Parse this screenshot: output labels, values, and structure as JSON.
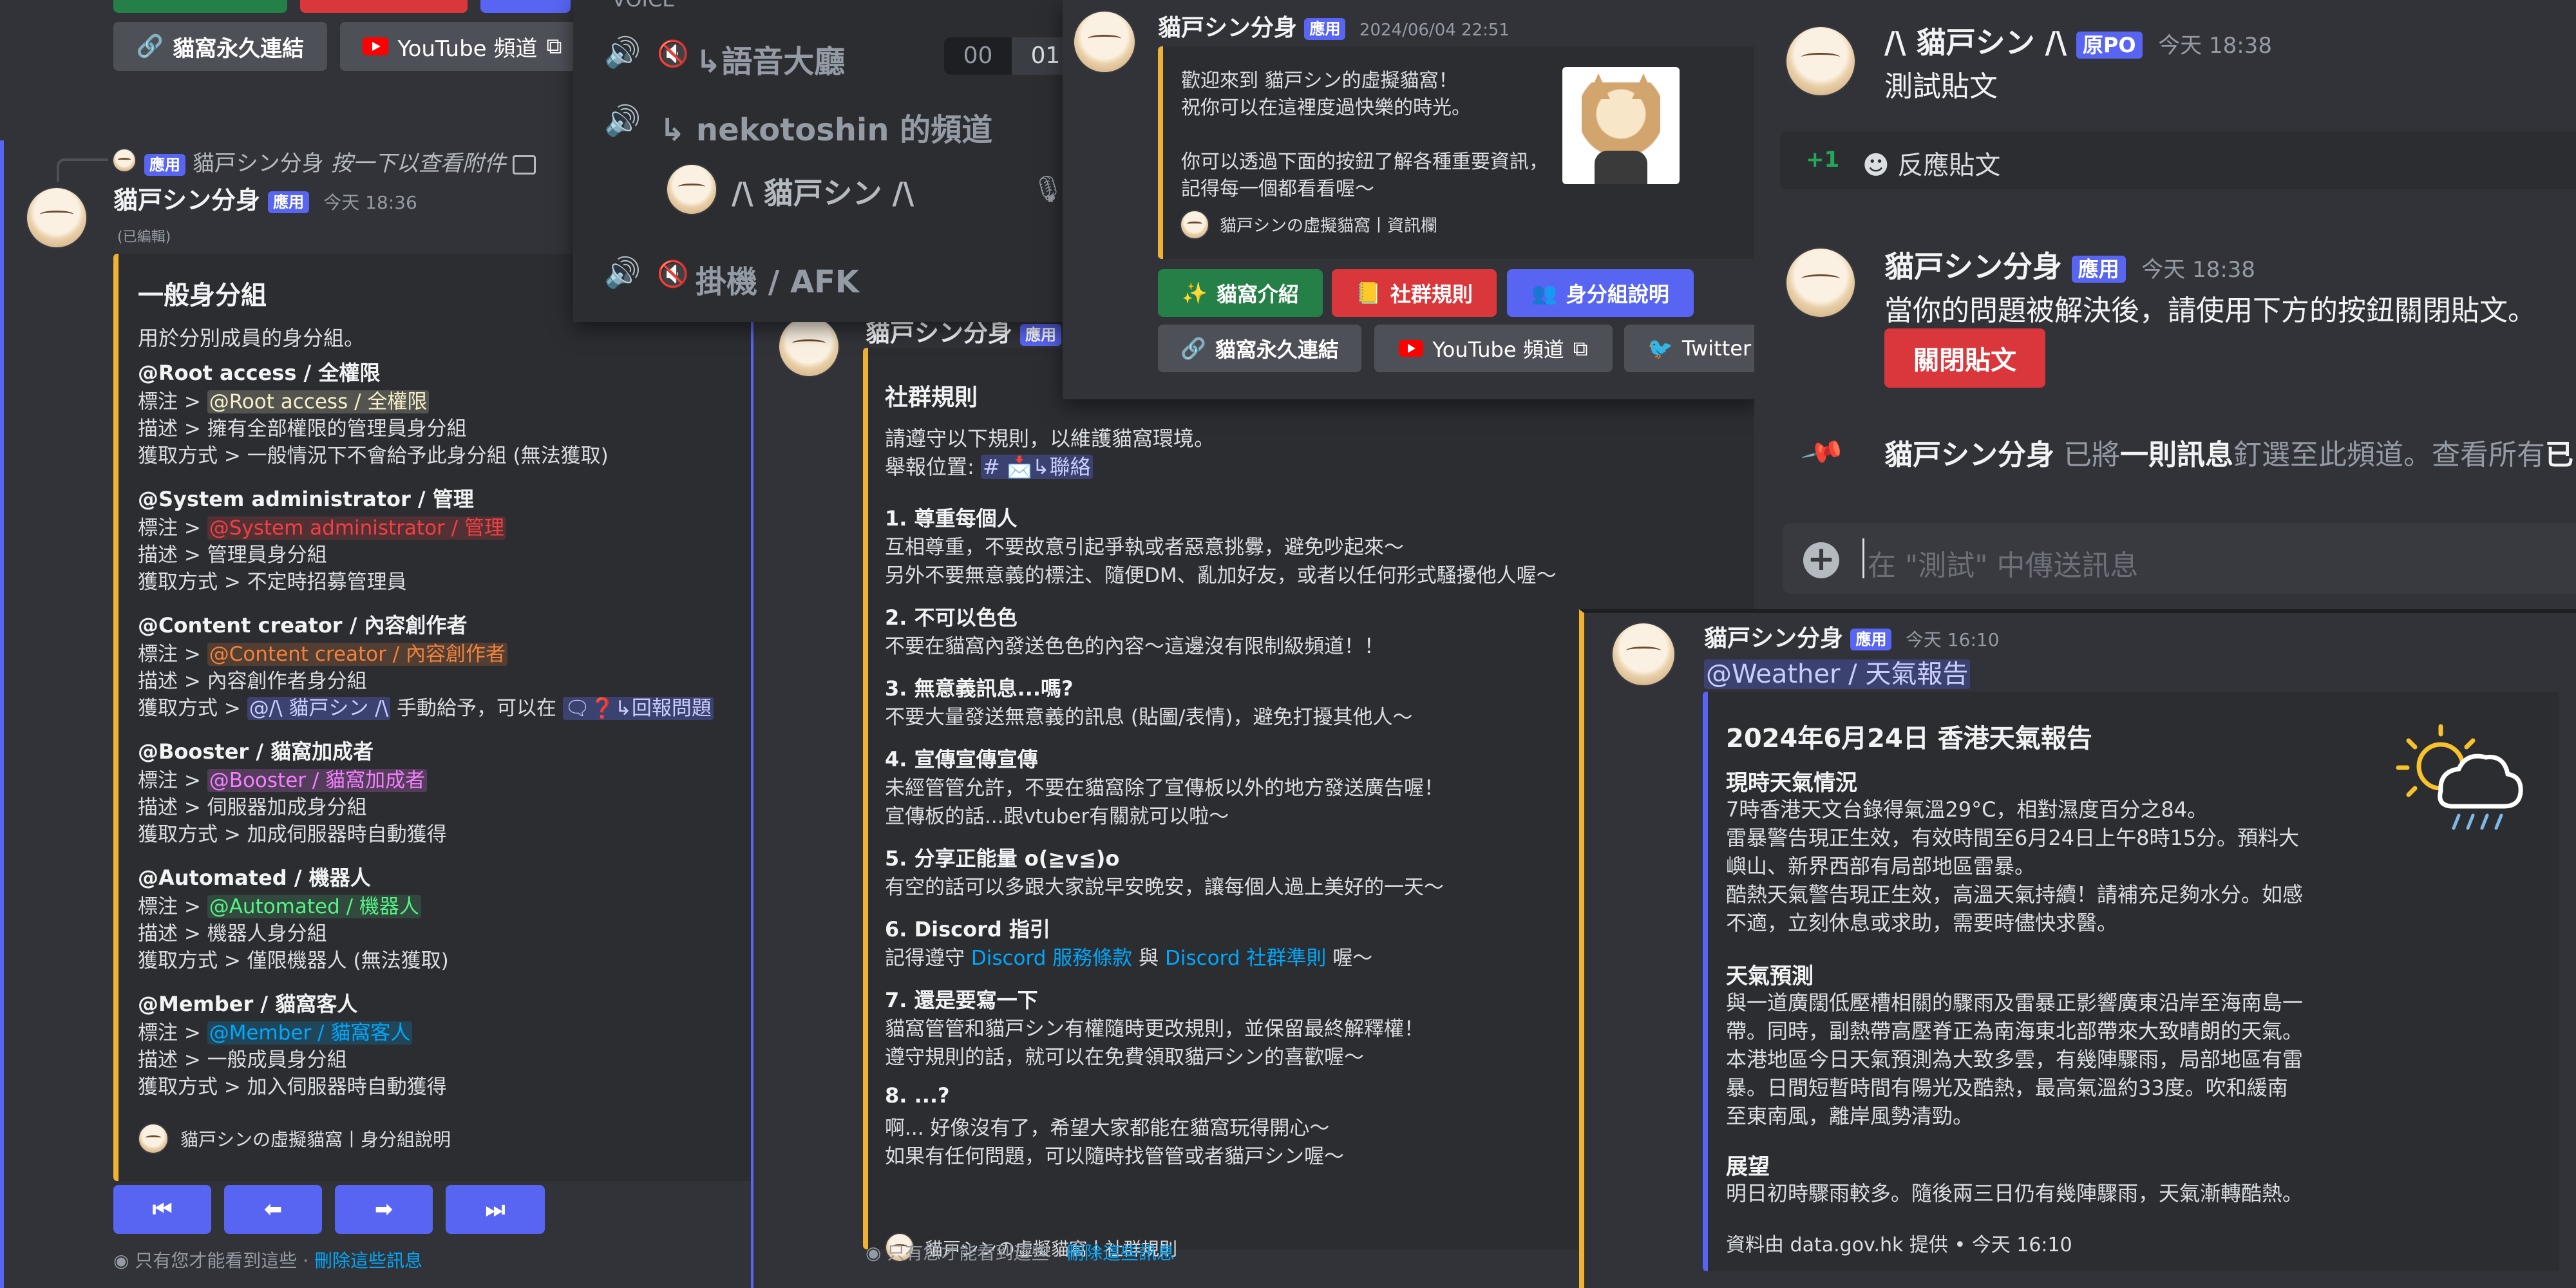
{
  "p1": {
    "top_buttons": {
      "perma": "貓窩永久連結",
      "youtube": "YouTube 頻道"
    },
    "reply": {
      "tag": "應用",
      "author": "貓戸シン分身",
      "text": "按一下以查看附件"
    },
    "author": "貓戸シン分身",
    "tag": "應用",
    "time": "今天 18:36",
    "edited": "(已編輯)",
    "embed": {
      "title": "一般身分組",
      "desc": "用於分別成員的身分組。",
      "sections": [
        {
          "head": "@Root access / 全權限",
          "l1a": "標注 > ",
          "l1b": "@Root access / 全權限",
          "l2": "描述 > 擁有全部權限的管理員身分組",
          "l3": "獲取方式 > 一般情況下不會給予此身分組 (無法獲取)",
          "color": "#f5f0c8",
          "bg": "rgba(245,240,200,0.2)"
        },
        {
          "head": "@System administrator / 管理",
          "l1a": "標注 > ",
          "l1b": "@System administrator / 管理",
          "l2": "描述 > 管理員身分組",
          "l3": "獲取方式 > 不定時招募管理員",
          "color": "#f23f43",
          "bg": "rgba(242,63,67,0.2)"
        },
        {
          "head": "@Content creator / 內容創作者",
          "l1a": "標注 > ",
          "l1b": "@Content creator / 內容創作者",
          "l2": "描述 > 內容創作者身分組",
          "l3": "獲取方式 > ",
          "color": "#f0823c",
          "bg": "rgba(240,130,60,0.2)"
        },
        {
          "head": "@Booster / 貓窩加成者",
          "l1a": "標注 > ",
          "l1b": "@Booster / 貓窩加成者",
          "l2": "描述 > 伺服器加成身分組",
          "l3": "獲取方式 > 加成伺服器時自動獲得",
          "color": "#f47fff",
          "bg": "rgba(244,127,255,0.2)"
        },
        {
          "head": "@Automated / 機器人",
          "l1a": "標注 > ",
          "l1b": "@Automated / 機器人",
          "l2": "描述 > 機器人身分組",
          "l3": "獲取方式 > 僅限機器人 (無法獲取)",
          "color": "#57f287",
          "bg": "rgba(87,242,135,0.15)"
        },
        {
          "head": "@Member / 貓窩客人",
          "l1a": "標注 > ",
          "l1b": "@Member / 貓窩客人",
          "l2": "描述 > 一般成員身分組",
          "l3": "獲取方式 > 加入伺服器時自動獲得",
          "color": "#00a8fc",
          "bg": "rgba(0,168,252,0.2)"
        }
      ],
      "cc_mention": "@/\\ 貓戸シン /\\",
      "cc_text": "手動給予，可以在",
      "cc_channel": "↳回報問題",
      "footer": "貓戸シンの虛擬貓窩丨身分組說明"
    },
    "nav": [
      "⏮",
      "⬅",
      "➡",
      "⏭"
    ],
    "ephemeral": {
      "text": "只有您才能看到這些 · ",
      "link": "刪除這些訊息"
    }
  },
  "p2": {
    "top": "VOICE",
    "channels": [
      {
        "name": "↳語音大廳",
        "count_a": "00",
        "count_b": "01"
      },
      {
        "name": "↳ nekotoshin 的頻道"
      },
      {
        "name": "掛機 / AFK"
      }
    ],
    "user": "/\\ 貓戸シン /\\"
  },
  "p3": {
    "author": "貓戸シン分身",
    "tag": "應用",
    "embed": {
      "title": "社群規則",
      "intro1": "請遵守以下規則，以維護貓窩環境。",
      "intro2a": "舉報位置: ",
      "intro2b": "# 📩↳聯絡",
      "rules": [
        {
          "h": "1. 尊重每個人",
          "l": [
            "互相尊重，不要故意引起爭執或者惡意挑釁，避免吵起來～",
            "另外不要無意義的標注、隨便DM、亂加好友，或者以任何形式騷擾他人喔～"
          ]
        },
        {
          "h": "2. 不可以色色",
          "l": [
            "不要在貓窩內發送色色的內容～這邊沒有限制級頻道！！"
          ]
        },
        {
          "h": "3. 無意義訊息...嗎?",
          "l": [
            "不要大量發送無意義的訊息 (貼圖/表情)，避免打擾其他人～"
          ]
        },
        {
          "h": "4. 宣傳宣傳宣傳",
          "l": [
            "未經管管允許，不要在貓窩除了宣傳板以外的地方發送廣告喔！",
            "宣傳板的話...跟vtuber有關就可以啦～"
          ]
        },
        {
          "h": "5. 分享正能量 o(≧v≦)o",
          "l": [
            "有空的話可以多跟大家說早安晚安，讓每個人過上美好的一天～"
          ]
        },
        {
          "h": "6. Discord 指引",
          "l": []
        },
        {
          "h": "7. 還是要寫一下",
          "l": [
            "貓窩管管和貓戸シン有權隨時更改規則，並保留最終解釋權！",
            "遵守規則的話，就可以在免費領取貓戸シン的喜歡喔～"
          ]
        },
        {
          "h": "8. ...?",
          "l": [
            "啊... 好像沒有了，希望大家都能在貓窩玩得開心～",
            "如果有任何問題，可以隨時找管管或者貓戸シン喔～"
          ]
        }
      ],
      "d6a": "記得遵守 ",
      "d6b": "Discord 服務條款",
      "d6c": " 與 ",
      "d6d": "Discord 社群準則",
      "d6e": " 喔～",
      "footer": "貓戸シンの虛擬貓窩丨社群規則"
    },
    "ephemeral": {
      "text": "只有您才能看到這些 · ",
      "link": "刪除這些訊息"
    }
  },
  "p4": {
    "author": "貓戸シン分身",
    "tag": "應用",
    "time": "2024/06/04 22:51",
    "lines": [
      "歡迎來到 貓戸シン的虛擬貓窩！",
      "祝你可以在這裡度過快樂的時光。",
      "",
      "你可以透過下面的按鈕了解各種重要資訊，",
      "記得每一個都看看喔～"
    ],
    "footer": "貓戸シンの虛擬貓窩丨資訊欄",
    "b_intro": "貓窩介紹",
    "b_rules": "社群規則",
    "b_roles": "身分組說明",
    "b_perma": "貓窩永久連結",
    "b_yt": "YouTube 頻道",
    "b_tw": "Twitter"
  },
  "p5": {
    "op": {
      "author": "/\\ 貓戸シン /\\",
      "tag": "原PO",
      "time": "今天 18:38",
      "text": "測試貼文"
    },
    "reaction": {
      "count": "+1",
      "label": "反應貼文"
    },
    "msg": {
      "author": "貓戸シン分身",
      "tag": "應用",
      "time": "今天 18:38",
      "text": "當你的問題被解決後，請使用下方的按鈕關閉貼文。",
      "button": "關閉貼文"
    },
    "pin": {
      "author": "貓戸シン分身",
      "t1": " 已將",
      "t2": "一則訊息",
      "t3": "釘選至此頻道。查看所有",
      "t4": "已"
    },
    "input_placeholder": "在 \"測試\" 中傳送訊息"
  },
  "p6": {
    "author": "貓戸シン分身",
    "tag": "應用",
    "time": "今天 16:10",
    "mention": "@Weather / 天氣報告",
    "title": "2024年6月24日 香港天氣報告",
    "s1": "現時天氣情況",
    "s1l": [
      "7時香港天文台錄得氣溫29°C，相對濕度百分之84。",
      "雷暴警告現正生效，有效時間至6月24日上午8時15分。預料大",
      "嶼山、新界西部有局部地區雷暴。",
      "酷熱天氣警告現正生效，高溫天氣持續！請補充足夠水分。如感",
      "不適，立刻休息或求助，需要時儘快求醫。"
    ],
    "s2": "天氣預測",
    "s2l": [
      "與一道廣闊低壓槽相關的驟雨及雷暴正影響廣東沿岸至海南島一",
      "帶。同時，副熱帶高壓脊正為南海東北部帶來大致晴朗的天氣。",
      "本港地區今日天氣預測為大致多雲，有幾陣驟雨，局部地區有雷",
      "暴。日間短暫時間有陽光及酷熱，最高氣溫約33度。吹和緩南",
      "至東南風，離岸風勢清勁。"
    ],
    "s3": "展望",
    "s3l": [
      "明日初時驟雨較多。隨後兩三日仍有幾陣驟雨，天氣漸轉酷熱。"
    ],
    "footer": "資料由 data.gov.hk 提供 • 今天 16:10"
  },
  "colors": {
    "embed_bar_default": "#f0b232",
    "blurple": "#5865f2",
    "green": "#248046",
    "red": "#da373c"
  }
}
